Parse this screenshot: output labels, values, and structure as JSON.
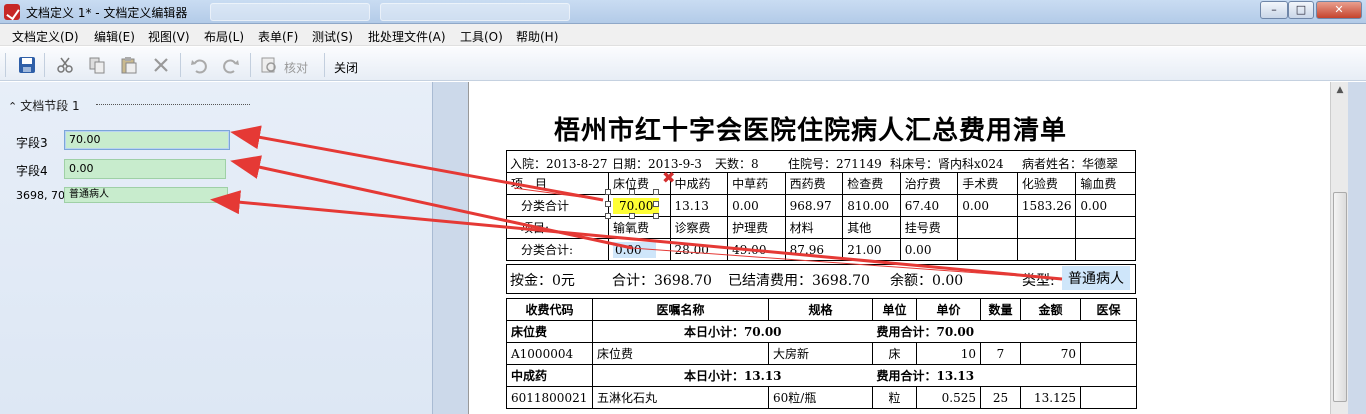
{
  "window": {
    "title": "文档定义 1* - 文档定义编辑器",
    "min_label": "–",
    "max_label": "□",
    "close_label": "✕"
  },
  "menu": [
    "文档定义(D)",
    "编辑(E)",
    "视图(V)",
    "布局(L)",
    "表单(F)",
    "测试(S)",
    "批处理文件(A)",
    "工具(O)",
    "帮助(H)"
  ],
  "toolbar": {
    "icons": [
      "save-icon",
      "cut-icon",
      "copy-icon",
      "paste-icon",
      "delete-icon",
      "undo-icon",
      "redo-icon",
      "proofread-icon"
    ],
    "proofread_label": "核对",
    "close_label": "关闭"
  },
  "left_panel": {
    "section_title": "文档节段 1",
    "fields": [
      {
        "label": "字段3",
        "value": "70.00"
      },
      {
        "label": "字段4",
        "value": "0.00"
      },
      {
        "label": "3698, 70",
        "value": "普通病人"
      }
    ]
  },
  "document": {
    "title": "梧州市红十字会医院住院病人汇总费用清单",
    "info": {
      "admit": "入院：2013-8-27",
      "date": "日期：2013-9-3",
      "days": "天数：8",
      "inpatient_no": "住院号：271149",
      "dept_bed": "科床号：肾内科x024",
      "patient": "病者姓名：华德翠"
    },
    "fee_table": [
      [
        "项　目",
        "床位费",
        "中成药",
        "中草药",
        "西药费",
        "检查费",
        "治疗费",
        "手术费",
        "化验费",
        "输血费"
      ],
      [
        "分类合计",
        "70.00",
        "13.13",
        "0.00",
        "968.97",
        "810.00",
        "67.40",
        "0.00",
        "1583.26",
        "0.00"
      ],
      [
        "项目:",
        "输氧费",
        "诊察费",
        "护理费",
        "材料",
        "其他",
        "挂号费",
        "",
        "",
        ""
      ],
      [
        "分类合计:",
        "0.00",
        "28.00",
        "49.00",
        "87.96",
        "21.00",
        "0.00",
        "",
        "",
        ""
      ]
    ],
    "summary": {
      "deposit": "按金：0元",
      "total": "合计：3698.70",
      "settled": "已结清费用：3698.70",
      "balance": "余额：0.00",
      "type_label": "类型:",
      "type_value": "普通病人"
    },
    "detail_header": [
      "收费代码",
      "医嘱名称",
      "规格",
      "单位",
      "单价",
      "数量",
      "金额",
      "医保"
    ],
    "detail_rows": [
      {
        "kind": "group",
        "name": "床位费",
        "day_subtotal": "本日小计：70.00",
        "fee_total": "费用合计：70.00"
      },
      {
        "kind": "item",
        "cells": [
          "A1000004",
          "床位费",
          "大房新",
          "床",
          "10",
          "7",
          "70",
          ""
        ]
      },
      {
        "kind": "group",
        "name": "中成药",
        "day_subtotal": "本日小计：13.13",
        "fee_total": "费用合计：13.13"
      },
      {
        "kind": "item",
        "cells": [
          "6011800021",
          "五淋化石丸",
          "60粒/瓶",
          "粒",
          "0.525",
          "25",
          "13.125",
          ""
        ]
      }
    ]
  },
  "colors": {
    "arrow": "#e53935",
    "field_bg": "#c8eccd",
    "highlight_yellow": "#ffff33",
    "highlight_blue": "#cfe6fa"
  }
}
